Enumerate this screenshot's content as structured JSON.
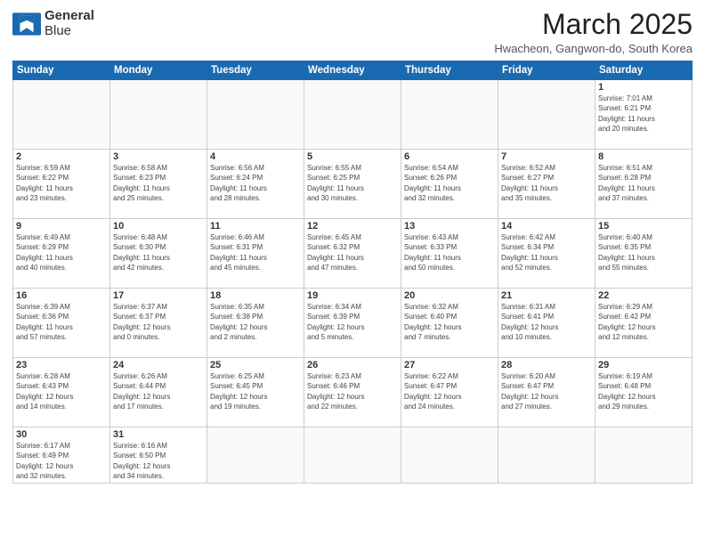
{
  "header": {
    "logo_line1": "General",
    "logo_line2": "Blue",
    "month_title": "March 2025",
    "location": "Hwacheon, Gangwon-do, South Korea"
  },
  "weekdays": [
    "Sunday",
    "Monday",
    "Tuesday",
    "Wednesday",
    "Thursday",
    "Friday",
    "Saturday"
  ],
  "weeks": [
    [
      {
        "day": "",
        "info": ""
      },
      {
        "day": "",
        "info": ""
      },
      {
        "day": "",
        "info": ""
      },
      {
        "day": "",
        "info": ""
      },
      {
        "day": "",
        "info": ""
      },
      {
        "day": "",
        "info": ""
      },
      {
        "day": "1",
        "info": "Sunrise: 7:01 AM\nSunset: 6:21 PM\nDaylight: 11 hours\nand 20 minutes."
      }
    ],
    [
      {
        "day": "2",
        "info": "Sunrise: 6:59 AM\nSunset: 6:22 PM\nDaylight: 11 hours\nand 23 minutes."
      },
      {
        "day": "3",
        "info": "Sunrise: 6:58 AM\nSunset: 6:23 PM\nDaylight: 11 hours\nand 25 minutes."
      },
      {
        "day": "4",
        "info": "Sunrise: 6:56 AM\nSunset: 6:24 PM\nDaylight: 11 hours\nand 28 minutes."
      },
      {
        "day": "5",
        "info": "Sunrise: 6:55 AM\nSunset: 6:25 PM\nDaylight: 11 hours\nand 30 minutes."
      },
      {
        "day": "6",
        "info": "Sunrise: 6:54 AM\nSunset: 6:26 PM\nDaylight: 11 hours\nand 32 minutes."
      },
      {
        "day": "7",
        "info": "Sunrise: 6:52 AM\nSunset: 6:27 PM\nDaylight: 11 hours\nand 35 minutes."
      },
      {
        "day": "8",
        "info": "Sunrise: 6:51 AM\nSunset: 6:28 PM\nDaylight: 11 hours\nand 37 minutes."
      }
    ],
    [
      {
        "day": "9",
        "info": "Sunrise: 6:49 AM\nSunset: 6:29 PM\nDaylight: 11 hours\nand 40 minutes."
      },
      {
        "day": "10",
        "info": "Sunrise: 6:48 AM\nSunset: 6:30 PM\nDaylight: 11 hours\nand 42 minutes."
      },
      {
        "day": "11",
        "info": "Sunrise: 6:46 AM\nSunset: 6:31 PM\nDaylight: 11 hours\nand 45 minutes."
      },
      {
        "day": "12",
        "info": "Sunrise: 6:45 AM\nSunset: 6:32 PM\nDaylight: 11 hours\nand 47 minutes."
      },
      {
        "day": "13",
        "info": "Sunrise: 6:43 AM\nSunset: 6:33 PM\nDaylight: 11 hours\nand 50 minutes."
      },
      {
        "day": "14",
        "info": "Sunrise: 6:42 AM\nSunset: 6:34 PM\nDaylight: 11 hours\nand 52 minutes."
      },
      {
        "day": "15",
        "info": "Sunrise: 6:40 AM\nSunset: 6:35 PM\nDaylight: 11 hours\nand 55 minutes."
      }
    ],
    [
      {
        "day": "16",
        "info": "Sunrise: 6:39 AM\nSunset: 6:36 PM\nDaylight: 11 hours\nand 57 minutes."
      },
      {
        "day": "17",
        "info": "Sunrise: 6:37 AM\nSunset: 6:37 PM\nDaylight: 12 hours\nand 0 minutes."
      },
      {
        "day": "18",
        "info": "Sunrise: 6:35 AM\nSunset: 6:38 PM\nDaylight: 12 hours\nand 2 minutes."
      },
      {
        "day": "19",
        "info": "Sunrise: 6:34 AM\nSunset: 6:39 PM\nDaylight: 12 hours\nand 5 minutes."
      },
      {
        "day": "20",
        "info": "Sunrise: 6:32 AM\nSunset: 6:40 PM\nDaylight: 12 hours\nand 7 minutes."
      },
      {
        "day": "21",
        "info": "Sunrise: 6:31 AM\nSunset: 6:41 PM\nDaylight: 12 hours\nand 10 minutes."
      },
      {
        "day": "22",
        "info": "Sunrise: 6:29 AM\nSunset: 6:42 PM\nDaylight: 12 hours\nand 12 minutes."
      }
    ],
    [
      {
        "day": "23",
        "info": "Sunrise: 6:28 AM\nSunset: 6:43 PM\nDaylight: 12 hours\nand 14 minutes."
      },
      {
        "day": "24",
        "info": "Sunrise: 6:26 AM\nSunset: 6:44 PM\nDaylight: 12 hours\nand 17 minutes."
      },
      {
        "day": "25",
        "info": "Sunrise: 6:25 AM\nSunset: 6:45 PM\nDaylight: 12 hours\nand 19 minutes."
      },
      {
        "day": "26",
        "info": "Sunrise: 6:23 AM\nSunset: 6:46 PM\nDaylight: 12 hours\nand 22 minutes."
      },
      {
        "day": "27",
        "info": "Sunrise: 6:22 AM\nSunset: 6:47 PM\nDaylight: 12 hours\nand 24 minutes."
      },
      {
        "day": "28",
        "info": "Sunrise: 6:20 AM\nSunset: 6:47 PM\nDaylight: 12 hours\nand 27 minutes."
      },
      {
        "day": "29",
        "info": "Sunrise: 6:19 AM\nSunset: 6:48 PM\nDaylight: 12 hours\nand 29 minutes."
      }
    ],
    [
      {
        "day": "30",
        "info": "Sunrise: 6:17 AM\nSunset: 6:49 PM\nDaylight: 12 hours\nand 32 minutes."
      },
      {
        "day": "31",
        "info": "Sunrise: 6:16 AM\nSunset: 6:50 PM\nDaylight: 12 hours\nand 34 minutes."
      },
      {
        "day": "",
        "info": ""
      },
      {
        "day": "",
        "info": ""
      },
      {
        "day": "",
        "info": ""
      },
      {
        "day": "",
        "info": ""
      },
      {
        "day": "",
        "info": ""
      }
    ]
  ]
}
